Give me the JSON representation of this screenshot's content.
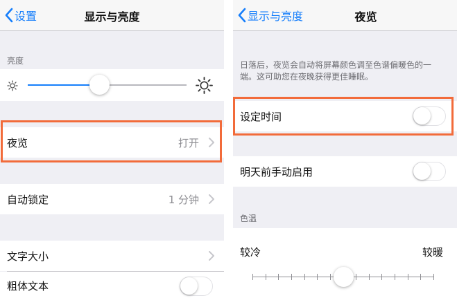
{
  "left": {
    "back_label": "设置",
    "title": "显示与亮度",
    "brightness_section": "亮度",
    "brightness_level": 0.45,
    "night_shift": {
      "label": "夜览",
      "value": "打开"
    },
    "auto_lock": {
      "label": "自动锁定",
      "value": "1 分钟"
    },
    "text_size": {
      "label": "文字大小"
    },
    "bold_text": {
      "label": "粗体文本",
      "on": false
    }
  },
  "right": {
    "back_label": "显示与亮度",
    "title": "夜览",
    "description": "日落后，夜览会自动将屏幕颜色调至色谱偏暖色的一端。这可助您在夜晚获得更佳睡眠。",
    "scheduled": {
      "label": "设定时间",
      "on": false
    },
    "manual": {
      "label": "明天前手动启用",
      "on": false
    },
    "color_temp_section": "色温",
    "cooler_label": "较冷",
    "warmer_label": "较暖",
    "color_temp_level": 0.5
  },
  "highlight_color": "#f26b3a",
  "ios_blue": "#157efb"
}
